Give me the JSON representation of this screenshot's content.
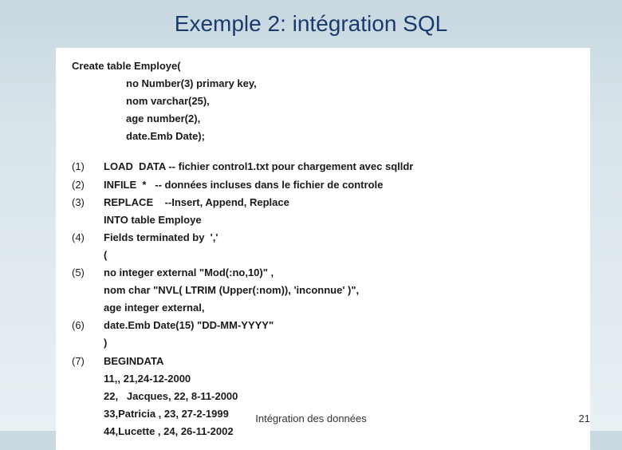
{
  "title": "Exemple 2: intégration SQL",
  "create": {
    "l0": "Create table Employe(",
    "l1": "no Number(3) primary key,",
    "l2": "nom varchar(25),",
    "l3": "age number(2),",
    "l4": "date.Emb Date);"
  },
  "load": {
    "n1": "(1)",
    "t1": "LOAD  DATA -- fichier control1.txt pour chargement avec sqlldr",
    "n2": "(2)",
    "t2": "INFILE  *   -- données incluses dans le fichier de controle",
    "n3": "(3)",
    "t3": "REPLACE    --Insert, Append, Replace",
    "t3b": "INTO table Employe",
    "n4": "(4)",
    "t4": "Fields terminated by  ','",
    "t4b": "(",
    "n5": "(5)",
    "t5": "no integer external \"Mod(:no,10)\" ,",
    "t5b": "nom char \"NVL( LTRIM (Upper(:nom)), 'inconnue' )\",",
    "t5c": "age integer external,",
    "n6": "(6)",
    "t6": "date.Emb Date(15) \"DD-MM-YYYY\"",
    "t6b": ")",
    "n7": "(7)",
    "t7": "BEGINDATA",
    "d1": "11,, 21,24-12-2000",
    "d2": "22,   Jacques, 22, 8-11-2000",
    "d3": "33,Patricia , 23, 27-2-1999",
    "d4": "44,Lucette , 24, 26-11-2002"
  },
  "footer": {
    "center": "Intégration des données",
    "page": "21"
  }
}
